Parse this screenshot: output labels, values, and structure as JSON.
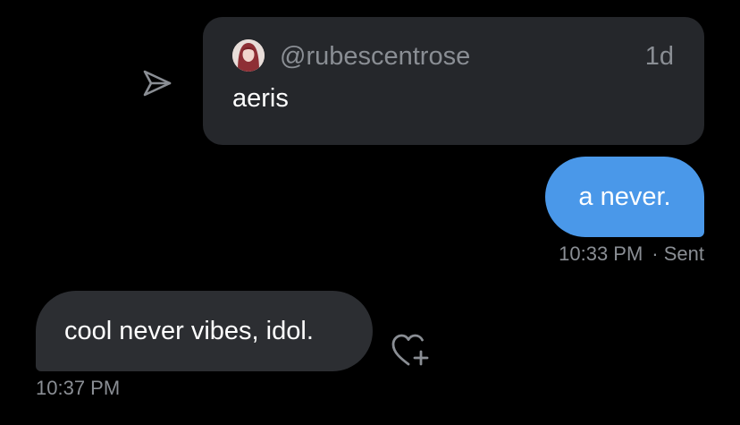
{
  "shared_tweet": {
    "handle": "@rubescentrose",
    "time": "1d",
    "text": "aeris"
  },
  "messages": [
    {
      "direction": "sent",
      "text": "a never.",
      "time": "10:33 PM",
      "status": "· Sent",
      "bubble_color": "#4a98e9"
    },
    {
      "direction": "received",
      "text": "cool never vibes, idol.",
      "time": "10:37 PM",
      "bubble_color": "#2c2e32"
    }
  ],
  "icons": {
    "share": "send-icon",
    "react": "heart-plus-icon",
    "avatar": "avatar"
  },
  "colors": {
    "background": "#000000",
    "card": "#25272b",
    "muted_text": "#8a8e94",
    "accent": "#4a98e9"
  }
}
